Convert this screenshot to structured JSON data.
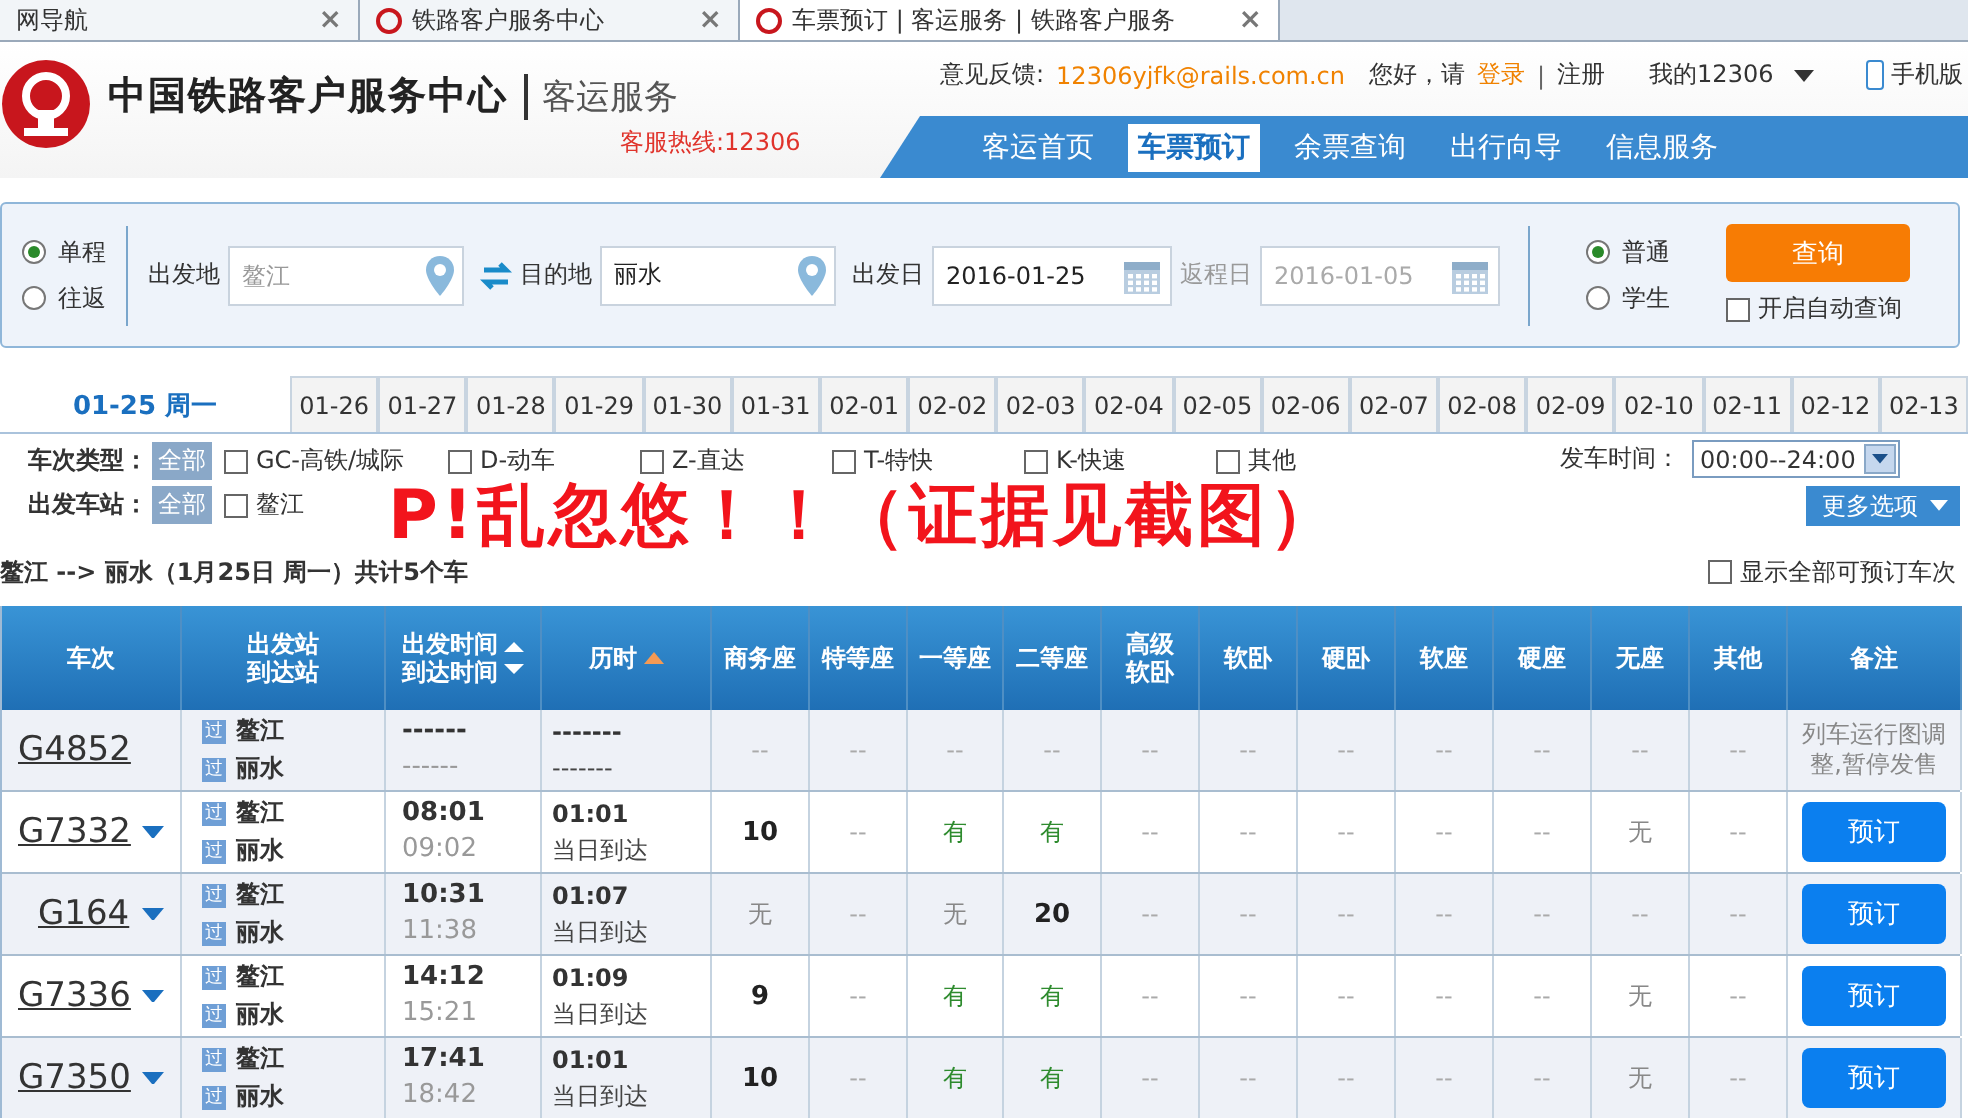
{
  "browser_tabs": [
    {
      "title": "网导航",
      "close": "×",
      "selected": false,
      "has_icon": false
    },
    {
      "title": "铁路客户服务中心",
      "close": "×",
      "selected": false,
      "has_icon": true
    },
    {
      "title": "车票预订 | 客运服务 | 铁路客户服务",
      "close": "×",
      "selected": true,
      "has_icon": true
    }
  ],
  "header": {
    "title": "中国铁路客户服务中心",
    "subtitle": "客运服务",
    "hotline": "客服热线:12306",
    "feedback_label": "意见反馈:",
    "feedback_email": "12306yjfk@rails.com.cn",
    "greeting": "您好，请",
    "login": "登录",
    "separator": "|",
    "register": "注册",
    "account": "我的12306",
    "mobile": "手机版",
    "nav": [
      {
        "label": "客运首页",
        "selected": false
      },
      {
        "label": "车票预订",
        "selected": true
      },
      {
        "label": "余票查询",
        "selected": false
      },
      {
        "label": "出行向导",
        "selected": false
      },
      {
        "label": "信息服务",
        "selected": false
      }
    ]
  },
  "search": {
    "trip_types": [
      {
        "label": "单程",
        "selected": true
      },
      {
        "label": "往返",
        "selected": false
      }
    ],
    "from_label": "出发地",
    "from_placeholder": "鳌江",
    "to_label": "目的地",
    "to_value": "丽水",
    "date_label": "出发日",
    "date_value": "2016-01-25",
    "return_label": "返程日",
    "return_value": "2016-01-05",
    "return_disabled": true,
    "passenger_types": [
      {
        "label": "普通",
        "selected": true
      },
      {
        "label": "学生",
        "selected": false
      }
    ],
    "query_button": "查询",
    "auto_query": {
      "label": "开启自动查询",
      "checked": false
    }
  },
  "dates": [
    {
      "label": "01-25 周一",
      "selected": true
    },
    {
      "label": "01-26",
      "selected": false
    },
    {
      "label": "01-27",
      "selected": false
    },
    {
      "label": "01-28",
      "selected": false
    },
    {
      "label": "01-29",
      "selected": false
    },
    {
      "label": "01-30",
      "selected": false
    },
    {
      "label": "01-31",
      "selected": false
    },
    {
      "label": "02-01",
      "selected": false
    },
    {
      "label": "02-02",
      "selected": false
    },
    {
      "label": "02-03",
      "selected": false
    },
    {
      "label": "02-04",
      "selected": false
    },
    {
      "label": "02-05",
      "selected": false
    },
    {
      "label": "02-06",
      "selected": false
    },
    {
      "label": "02-07",
      "selected": false
    },
    {
      "label": "02-08",
      "selected": false
    },
    {
      "label": "02-09",
      "selected": false
    },
    {
      "label": "02-10",
      "selected": false
    },
    {
      "label": "02-11",
      "selected": false
    },
    {
      "label": "02-12",
      "selected": false
    },
    {
      "label": "02-13",
      "selected": false
    }
  ],
  "filters": {
    "type_label": "车次类型：",
    "type_all": "全部",
    "types": [
      {
        "label": "GC-高铁/城际",
        "checked": false
      },
      {
        "label": "D-动车",
        "checked": false
      },
      {
        "label": "Z-直达",
        "checked": false
      },
      {
        "label": "T-特快",
        "checked": false
      },
      {
        "label": "K-快速",
        "checked": false
      },
      {
        "label": "其他",
        "checked": false
      }
    ],
    "station_label": "出发车站：",
    "station_all": "全部",
    "stations": [
      {
        "label": "鳌江",
        "checked": false
      }
    ],
    "time_label": "发车时间：",
    "time_value": "00:00--24:00",
    "more": "更多选项"
  },
  "annotation": "P!乱忽悠！！（证据见截图）",
  "summary": "鳌江 --> 丽水（1月25日  周一）共计5个车",
  "show_all": {
    "label": "显示全部可预订车次",
    "checked": false
  },
  "table": {
    "columns": [
      {
        "lines": [
          "车次"
        ],
        "kind": "plain"
      },
      {
        "lines": [
          "出发站",
          "到达站"
        ],
        "kind": "plain"
      },
      {
        "lines": [
          "出发时间",
          "到达时间"
        ],
        "kind": "sortboth"
      },
      {
        "lines": [
          "历时"
        ],
        "kind": "sortup"
      },
      {
        "lines": [
          "商务座"
        ],
        "kind": "plain"
      },
      {
        "lines": [
          "特等座"
        ],
        "kind": "plain"
      },
      {
        "lines": [
          "一等座"
        ],
        "kind": "plain"
      },
      {
        "lines": [
          "二等座"
        ],
        "kind": "plain"
      },
      {
        "lines": [
          "高级",
          "软卧"
        ],
        "kind": "plain"
      },
      {
        "lines": [
          "软卧"
        ],
        "kind": "plain"
      },
      {
        "lines": [
          "硬卧"
        ],
        "kind": "plain"
      },
      {
        "lines": [
          "软座"
        ],
        "kind": "plain"
      },
      {
        "lines": [
          "硬座"
        ],
        "kind": "plain"
      },
      {
        "lines": [
          "无座"
        ],
        "kind": "plain"
      },
      {
        "lines": [
          "其他"
        ],
        "kind": "plain"
      },
      {
        "lines": [
          "备注"
        ],
        "kind": "plain"
      }
    ],
    "rows": [
      {
        "train": "G4852",
        "dropdown": false,
        "from_mark": "过",
        "from": "鳌江",
        "to_mark": "过",
        "to": "丽水",
        "depart": "------",
        "arrive": "------",
        "duration": "-------",
        "arrival_day": "-------",
        "seats": [
          {
            "text": "--",
            "kind": "na"
          },
          {
            "text": "--",
            "kind": "na"
          },
          {
            "text": "--",
            "kind": "na"
          },
          {
            "text": "--",
            "kind": "na"
          },
          {
            "text": "--",
            "kind": "na"
          },
          {
            "text": "--",
            "kind": "na"
          },
          {
            "text": "--",
            "kind": "na"
          },
          {
            "text": "--",
            "kind": "na"
          },
          {
            "text": "--",
            "kind": "na"
          },
          {
            "text": "--",
            "kind": "na"
          },
          {
            "text": "--",
            "kind": "na"
          }
        ],
        "remark": "列车运行图调整,暂停发售"
      },
      {
        "train": "G7332",
        "dropdown": true,
        "from_mark": "过",
        "from": "鳌江",
        "to_mark": "过",
        "to": "丽水",
        "depart": "08:01",
        "arrive": "09:02",
        "duration": "01:01",
        "arrival_day": "当日到达",
        "seats": [
          {
            "text": "10",
            "kind": "count"
          },
          {
            "text": "--",
            "kind": "na"
          },
          {
            "text": "有",
            "kind": "available"
          },
          {
            "text": "有",
            "kind": "available"
          },
          {
            "text": "--",
            "kind": "na"
          },
          {
            "text": "--",
            "kind": "na"
          },
          {
            "text": "--",
            "kind": "na"
          },
          {
            "text": "--",
            "kind": "na"
          },
          {
            "text": "--",
            "kind": "na"
          },
          {
            "text": "无",
            "kind": "none"
          },
          {
            "text": "--",
            "kind": "na"
          }
        ],
        "button": "预订"
      },
      {
        "train": "G164",
        "dropdown": true,
        "from_mark": "过",
        "from": "鳌江",
        "to_mark": "过",
        "to": "丽水",
        "depart": "10:31",
        "arrive": "11:38",
        "duration": "01:07",
        "arrival_day": "当日到达",
        "seats": [
          {
            "text": "无",
            "kind": "none"
          },
          {
            "text": "--",
            "kind": "na"
          },
          {
            "text": "无",
            "kind": "none"
          },
          {
            "text": "20",
            "kind": "count"
          },
          {
            "text": "--",
            "kind": "na"
          },
          {
            "text": "--",
            "kind": "na"
          },
          {
            "text": "--",
            "kind": "na"
          },
          {
            "text": "--",
            "kind": "na"
          },
          {
            "text": "--",
            "kind": "na"
          },
          {
            "text": "--",
            "kind": "na"
          },
          {
            "text": "--",
            "kind": "na"
          }
        ],
        "button": "预订"
      },
      {
        "train": "G7336",
        "dropdown": true,
        "from_mark": "过",
        "from": "鳌江",
        "to_mark": "过",
        "to": "丽水",
        "depart": "14:12",
        "arrive": "15:21",
        "duration": "01:09",
        "arrival_day": "当日到达",
        "seats": [
          {
            "text": "9",
            "kind": "count"
          },
          {
            "text": "--",
            "kind": "na"
          },
          {
            "text": "有",
            "kind": "available"
          },
          {
            "text": "有",
            "kind": "available"
          },
          {
            "text": "--",
            "kind": "na"
          },
          {
            "text": "--",
            "kind": "na"
          },
          {
            "text": "--",
            "kind": "na"
          },
          {
            "text": "--",
            "kind": "na"
          },
          {
            "text": "--",
            "kind": "na"
          },
          {
            "text": "无",
            "kind": "none"
          },
          {
            "text": "--",
            "kind": "na"
          }
        ],
        "button": "预订"
      },
      {
        "train": "G7350",
        "dropdown": true,
        "from_mark": "过",
        "from": "鳌江",
        "to_mark": "过",
        "to": "丽水",
        "depart": "17:41",
        "arrive": "18:42",
        "duration": "01:01",
        "arrival_day": "当日到达",
        "seats": [
          {
            "text": "10",
            "kind": "count"
          },
          {
            "text": "--",
            "kind": "na"
          },
          {
            "text": "有",
            "kind": "available"
          },
          {
            "text": "有",
            "kind": "available"
          },
          {
            "text": "--",
            "kind": "na"
          },
          {
            "text": "--",
            "kind": "na"
          },
          {
            "text": "--",
            "kind": "na"
          },
          {
            "text": "--",
            "kind": "na"
          },
          {
            "text": "--",
            "kind": "na"
          },
          {
            "text": "无",
            "kind": "none"
          },
          {
            "text": "--",
            "kind": "na"
          }
        ],
        "button": "预订"
      }
    ]
  }
}
